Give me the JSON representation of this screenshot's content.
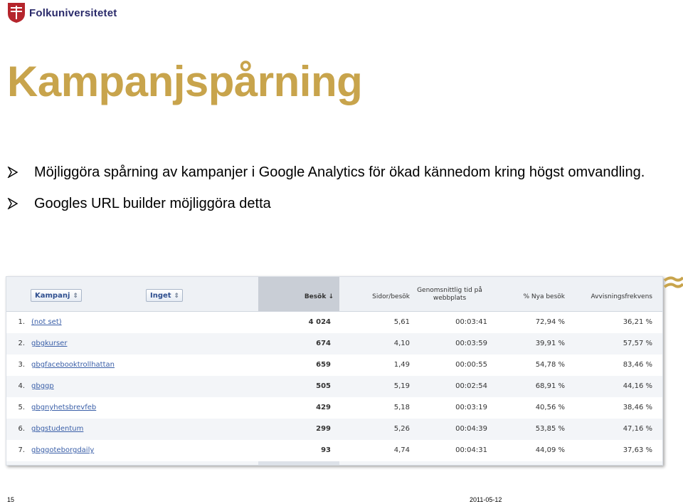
{
  "brand": {
    "name": "Folkuniversitetet"
  },
  "title": "Kampanjspårning",
  "bullets": [
    "Möjliggöra spårning av kampanjer i Google Analytics för ökad kännedom kring högst omvandling.",
    "Googles URL builder möjliggöra detta"
  ],
  "table": {
    "dimension_select": "Kampanj",
    "secondary_select": "Inget",
    "headers": {
      "visits": "Besök",
      "pages": "Sidor/besök",
      "time_line1": "Genomsnittlig tid på",
      "time_line2": "webbplats",
      "new_visits": "% Nya besök",
      "bounce": "Avvisningsfrekvens"
    },
    "rows": [
      {
        "num": "1.",
        "name": "(not set)",
        "visits": "4 024",
        "pages": "5,61",
        "time": "00:03:41",
        "new": "72,94 %",
        "bounce": "36,21 %"
      },
      {
        "num": "2.",
        "name": "gbgkurser",
        "visits": "674",
        "pages": "4,10",
        "time": "00:03:59",
        "new": "39,91 %",
        "bounce": "57,57 %"
      },
      {
        "num": "3.",
        "name": "gbgfacebooktrollhattan",
        "visits": "659",
        "pages": "1,49",
        "time": "00:00:55",
        "new": "54,78 %",
        "bounce": "83,46 %"
      },
      {
        "num": "4.",
        "name": "gbggp",
        "visits": "505",
        "pages": "5,19",
        "time": "00:02:54",
        "new": "68,91 %",
        "bounce": "44,16 %"
      },
      {
        "num": "5.",
        "name": "gbgnyhetsbrevfeb",
        "visits": "429",
        "pages": "5,18",
        "time": "00:03:19",
        "new": "40,56 %",
        "bounce": "38,46 %"
      },
      {
        "num": "6.",
        "name": "gbgstudentum",
        "visits": "299",
        "pages": "5,26",
        "time": "00:04:39",
        "new": "53,85 %",
        "bounce": "47,16 %"
      },
      {
        "num": "7.",
        "name": "gbggoteborgdaily",
        "visits": "93",
        "pages": "4,74",
        "time": "00:04:31",
        "new": "44,09 %",
        "bounce": "37,63 %"
      }
    ]
  },
  "footer": {
    "page_number": "15",
    "date": "2011-05-12"
  },
  "colors": {
    "title": "#c8a44c",
    "logo_red": "#b5252c",
    "link_blue": "#3a5fa8"
  },
  "icons": {
    "bullet": "arrowhead-bullet-icon",
    "sort": "sort-down-arrow-icon",
    "select": "select-chevron-icon"
  }
}
